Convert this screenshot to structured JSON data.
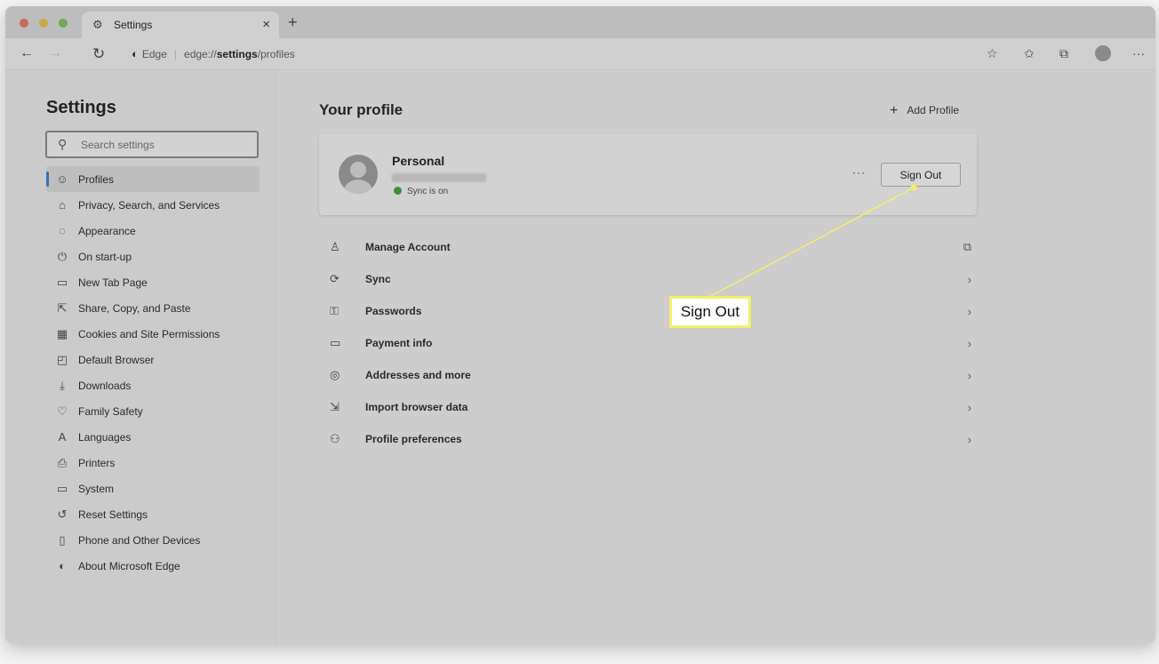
{
  "browser": {
    "tab_title": "Settings",
    "tab_close": "×",
    "new_tab": "+",
    "address_brand": "Edge",
    "address_prefix": "edge://",
    "address_bold": "settings",
    "address_suffix": "/profiles",
    "toolbar_icons": [
      "favorites-add-icon",
      "favorites-icon",
      "collections-icon",
      "profile-icon",
      "more-icon"
    ],
    "more_label": "···"
  },
  "sidebar": {
    "title": "Settings",
    "search_placeholder": "Search settings",
    "items": [
      {
        "label": "Profiles",
        "icon": "profile-icon",
        "active": true
      },
      {
        "label": "Privacy, Search, and Services",
        "icon": "lock-icon"
      },
      {
        "label": "Appearance",
        "icon": "palette-icon"
      },
      {
        "label": "On start-up",
        "icon": "power-icon"
      },
      {
        "label": "New Tab Page",
        "icon": "new-tab-icon"
      },
      {
        "label": "Share, Copy, and Paste",
        "icon": "share-icon"
      },
      {
        "label": "Cookies and Site Permissions",
        "icon": "cookie-icon"
      },
      {
        "label": "Default Browser",
        "icon": "browser-icon"
      },
      {
        "label": "Downloads",
        "icon": "download-icon"
      },
      {
        "label": "Family Safety",
        "icon": "family-icon"
      },
      {
        "label": "Languages",
        "icon": "language-icon"
      },
      {
        "label": "Printers",
        "icon": "printer-icon"
      },
      {
        "label": "System",
        "icon": "system-icon"
      },
      {
        "label": "Reset Settings",
        "icon": "reset-icon"
      },
      {
        "label": "Phone and Other Devices",
        "icon": "phone-icon"
      },
      {
        "label": "About Microsoft Edge",
        "icon": "edge-icon"
      }
    ]
  },
  "main": {
    "heading": "Your profile",
    "add_profile": "Add Profile",
    "profile": {
      "name": "Personal",
      "sync_status": "Sync is on",
      "more": "···",
      "sign_out": "Sign Out"
    },
    "menu": [
      {
        "label": "Manage Account",
        "icon": "person-icon",
        "trail": "external-link-icon"
      },
      {
        "label": "Sync",
        "icon": "sync-icon",
        "trail": "chevron-right-icon"
      },
      {
        "label": "Passwords",
        "icon": "key-icon",
        "trail": "chevron-right-icon"
      },
      {
        "label": "Payment info",
        "icon": "card-icon",
        "trail": "chevron-right-icon"
      },
      {
        "label": "Addresses and more",
        "icon": "location-icon",
        "trail": "chevron-right-icon"
      },
      {
        "label": "Import browser data",
        "icon": "import-icon",
        "trail": "chevron-right-icon"
      },
      {
        "label": "Profile preferences",
        "icon": "people-settings-icon",
        "trail": "chevron-right-icon"
      }
    ]
  },
  "callout": {
    "label": "Sign Out",
    "color": "#f3ef6b"
  }
}
